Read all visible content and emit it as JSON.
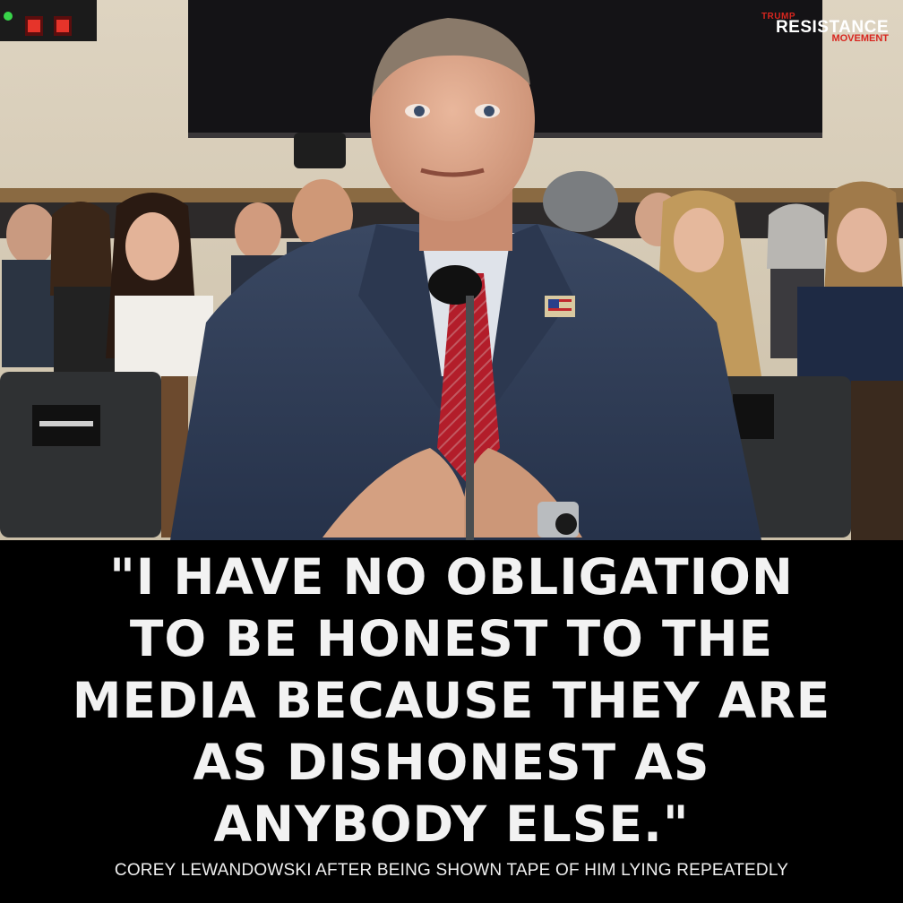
{
  "logo": {
    "line1": "TRUMP",
    "line2": "RESISTANCE",
    "line3": "MOVEMENT"
  },
  "quote": {
    "lines": [
      "\"I HAVE NO OBLIGATION",
      "TO BE HONEST TO THE",
      "MEDIA BECAUSE THEY ARE",
      "AS DISHONEST AS",
      "ANYBODY ELSE.\""
    ]
  },
  "caption": "COREY LEWANDOWSKI AFTER BEING SHOWN TAPE OF HIM LYING REPEATEDLY",
  "colors": {
    "background": "#000000",
    "text": "#f2f2f2",
    "brand_red": "#d8261f"
  }
}
